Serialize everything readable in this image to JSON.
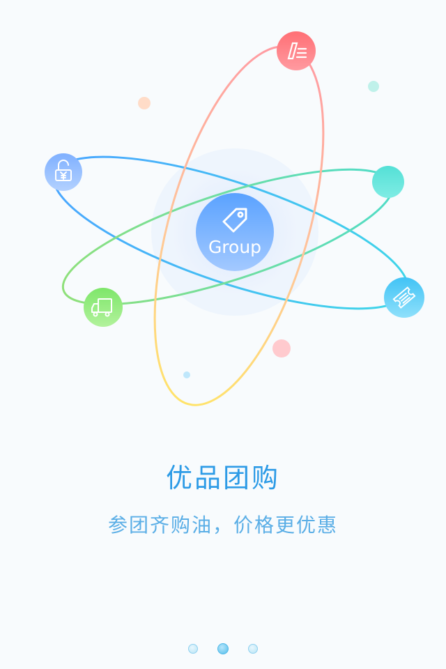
{
  "center": {
    "label": "Group"
  },
  "headline": "优品团购",
  "subline": "参团齐购油，价格更优惠",
  "pager": {
    "total": 3,
    "active_index": 1
  },
  "colors": {
    "headline": "#2d9be6",
    "subline": "#5aaee6",
    "center_gradient_top": "#5aa9ff",
    "center_gradient_bottom": "#9bc6ff"
  },
  "icons": [
    "tag-icon",
    "pencil-list-icon",
    "unlock-yuan-icon",
    "truck-icon",
    "ticket-icon"
  ]
}
